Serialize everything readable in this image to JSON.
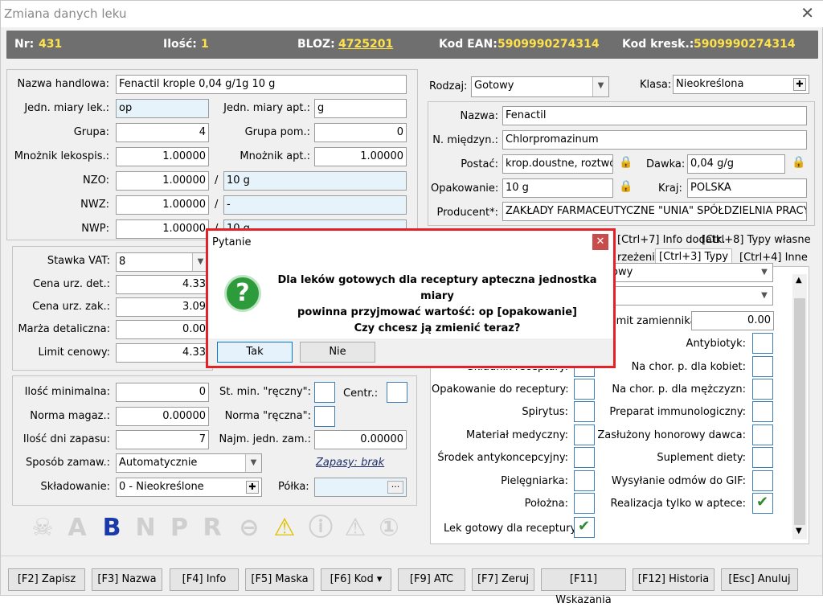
{
  "window": {
    "title": "Zmiana danych leku",
    "close": "✕"
  },
  "header": {
    "nr_label": "Nr:",
    "nr": "431",
    "ilosc_label": "Ilość:",
    "ilosc": "1",
    "bloz_label": "BLOZ:",
    "bloz": "4725201",
    "ean_label": "Kod EAN:",
    "ean": "5909990274314",
    "kresk_label": "Kod kresk.:",
    "kresk": "5909990274314"
  },
  "left": {
    "nazwa_handlowa_label": "Nazwa handlowa:",
    "nazwa_handlowa": "Fenactil krople 0,04 g/1g 10 g",
    "jedn_lek_label": "Jedn. miary lek.:",
    "jedn_lek": "op",
    "jedn_apt_label": "Jedn. miary apt.:",
    "jedn_apt": "g",
    "grupa_label": "Grupa:",
    "grupa": "4",
    "grupa_pom_label": "Grupa pom.:",
    "grupa_pom": "0",
    "mnoznik_lek_label": "Mnożnik lekospis.:",
    "mnoznik_lek": "1.00000",
    "mnoznik_apt_label": "Mnożnik apt.:",
    "mnoznik_apt": "1.00000",
    "nzo_label": "NZO:",
    "nzo": "1.00000",
    "nzo_unit": "10 g",
    "nwz_label": "NWZ:",
    "nwz": "1.00000",
    "nwz_unit": "-",
    "nwp_label": "NWP:",
    "nwp": "1.00000",
    "nwp_unit": "10 g",
    "slash": "/"
  },
  "prices": {
    "vat_label": "Stawka VAT:",
    "vat": "8",
    "cena_det_label": "Cena urz. det.:",
    "cena_det": "4.33",
    "cena_zak_label": "Cena urz. zak.:",
    "cena_zak": "3.09",
    "marza_label": "Marża detaliczna:",
    "marza": "0.00",
    "limit_label": "Limit cenowy:",
    "limit": "4.33"
  },
  "stock": {
    "ilosc_min_label": "Ilość minimalna:",
    "ilosc_min": "0",
    "st_min_label": "St. min. \"ręczny\":",
    "centr_label": "Centr.:",
    "norma_label": "Norma magaz.:",
    "norma": "0.00000",
    "norma_r_label": "Norma \"ręczna\":",
    "dni_label": "Ilość dni zapasu:",
    "dni": "7",
    "najm_label": "Najm. jedn. zam.:",
    "najm": "0.00000",
    "sposob_label": "Sposób zamaw.:",
    "sposob": "Automatycznie",
    "zapasy": "Zapasy: brak",
    "skladowanie_label": "Składowanie:",
    "skladowanie": "0 - Nieokreślone",
    "polka_label": "Półka:",
    "polka_btn": "···"
  },
  "icons": [
    "☠",
    "A",
    "B",
    "N",
    "P",
    "R",
    "⊖",
    "⚠",
    "ⓘ",
    "⚠",
    "①"
  ],
  "right": {
    "rodzaj_label": "Rodzaj:",
    "rodzaj": "Gotowy",
    "klasa_label": "Klasa:",
    "klasa": "Nieokreślona",
    "nazwa_label": "Nazwa:",
    "nazwa": "Fenactil",
    "miedzyn_label": "N. międzyn.:",
    "miedzyn": "Chlorpromazinum",
    "postac_label": "Postać:",
    "postac": "krop.doustne, roztwór",
    "dawka_label": "Dawka:",
    "dawka": "0,04 g/g",
    "opak_label": "Opakowanie:",
    "opak": "10 g",
    "kraj_label": "Kraj:",
    "kraj": "POLSKA",
    "producent_label": "Producent*:",
    "producent": "ZAKŁADY FARMACEUTYCZNE \"UNIA\" SPÓŁDZIELNIA PRACY"
  },
  "tabs": {
    "t1": "[Ctrl+7] Info dodatk.",
    "t2": "[Ctrl+8] Typy własne",
    "t3": "rzeżenia",
    "t4": "[Ctrl+3] Typy",
    "t5": "[Ctrl+4] Inne"
  },
  "types": {
    "combo1": "owy",
    "limit_zam_label": "imit zamiennika:",
    "limit_zam": "0.00",
    "antybiotyk": "Antybiotyk:",
    "skladnik": "Składnik receptury:",
    "kobiet": "Na chor. p. dla kobiet:",
    "opak_rec": "Opakowanie do receptury:",
    "mezczyzn": "Na chor. p. dla mężczyzn:",
    "spirytus": "Spirytus:",
    "immuno": "Preparat immunologiczny:",
    "material": "Materiał medyczny:",
    "honorowy": "Zasłużony honorowy dawca:",
    "antykonc": "Środek antykoncepcyjny:",
    "suplement": "Suplement diety:",
    "pielegniarka": "Pielęgniarka:",
    "gif": "Wysyłanie odmów do GIF:",
    "polozna": "Położna:",
    "apteka": "Realizacja tylko w aptece:",
    "lek_gotowy": "Lek gotowy dla receptury"
  },
  "dialog": {
    "title": "Pytanie",
    "close": "✕",
    "icon": "?",
    "line1": "Dla leków gotowych dla receptury apteczna jednostka miary",
    "line2": "powinna przyjmować wartość: op [opakowanie]",
    "line3": "Czy chcesz ją zmienić teraz?",
    "yes": "Tak",
    "no": "Nie"
  },
  "footer": [
    "[F2] Zapisz",
    "[F3] Nazwa",
    "[F4] Info",
    "[F5] Maska",
    "[F6] Kod ▾",
    "[F9] ATC",
    "[F7] Zeruj",
    "[F11] Wskazania",
    "[F12] Historia",
    "[Esc] Anuluj"
  ]
}
